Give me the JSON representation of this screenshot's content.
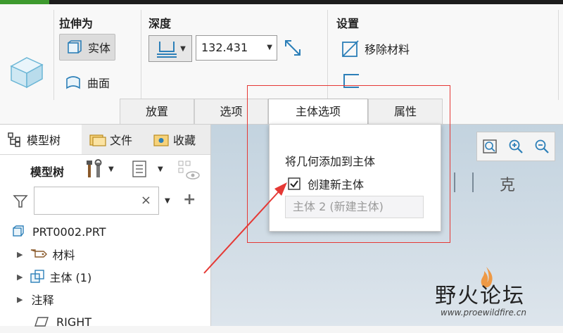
{
  "ribbon": {
    "extrude_as_label": "拉伸为",
    "solid_label": "实体",
    "surface_label": "曲面",
    "depth_label": "深度",
    "depth_value": "132.431",
    "settings_label": "设置",
    "remove_material_label": "移除材料"
  },
  "tabs": [
    {
      "label": "放置"
    },
    {
      "label": "选项"
    },
    {
      "label": "主体选项"
    },
    {
      "label": "属性"
    }
  ],
  "body_options": {
    "add_geometry_label": "将几何添加到主体",
    "create_new_body_label": "创建新主体",
    "create_new_body_checked": true,
    "body_field_value": "主体 2 (新建主体)"
  },
  "navigator": {
    "tabs": [
      {
        "label": "模型树"
      },
      {
        "label": "文件"
      },
      {
        "label": "收藏"
      }
    ],
    "toolbar_label": "模型树",
    "filter_clear": "×",
    "tree": [
      {
        "label": "PRT0002.PRT"
      },
      {
        "label": "材料"
      },
      {
        "label": "主体 (1)"
      },
      {
        "label": "注释"
      },
      {
        "label": "RIGHT"
      }
    ]
  },
  "graphics": {
    "partial_text": "克",
    "watermark_title": "野火论坛",
    "watermark_url": "www.proewildfire.cn"
  },
  "colors": {
    "accent_red": "#e53935",
    "title_green": "#3e9a2e",
    "icon_blue": "#2c7fb8"
  }
}
